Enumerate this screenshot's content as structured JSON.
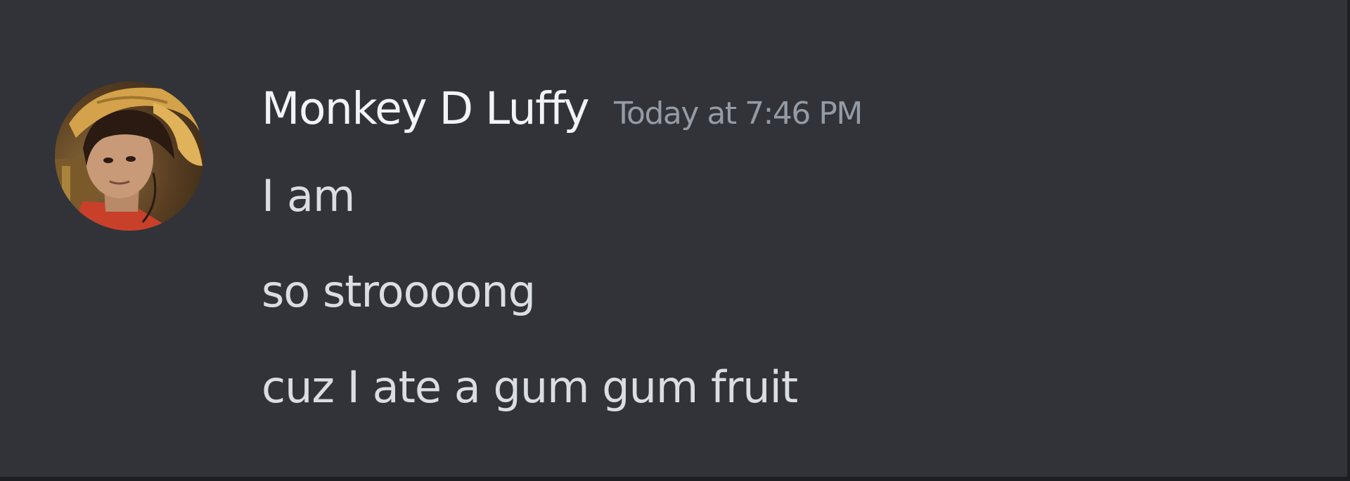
{
  "message": {
    "author": "Monkey D Luffy",
    "timestamp": "Today at 7:46 PM",
    "lines": [
      "I am",
      "so stroooong",
      "cuz I ate a gum gum fruit"
    ]
  },
  "avatar": {
    "icon": "user-avatar-straw-hat",
    "colors": {
      "hat": "#d4a24a",
      "hair": "#2a1a12",
      "skin": "#c89a78",
      "shirt": "#c8402a",
      "background": "#6b4a2a"
    }
  },
  "theme": {
    "background": "#313338",
    "border": "#1e1f22",
    "username_color": "#f2f3f5",
    "timestamp_color": "#949ba4",
    "text_color": "#dbdee1"
  }
}
